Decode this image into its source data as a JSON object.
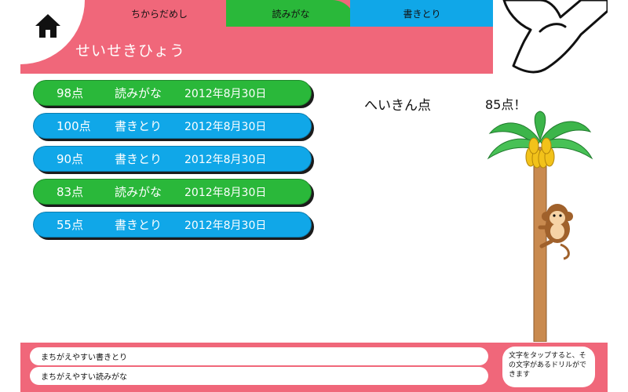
{
  "header": {
    "title": "せいせきひょう",
    "tabs": [
      {
        "label": "ちからだめし",
        "color": "#f0677a"
      },
      {
        "label": "読みがな",
        "color": "#2ab83a"
      },
      {
        "label": "書きとり",
        "color": "#10a7e8"
      }
    ]
  },
  "scores": [
    {
      "score": "98点",
      "type": "読みがな",
      "date": "2012年8月30日",
      "color": "green"
    },
    {
      "score": "100点",
      "type": "書きとり",
      "date": "2012年8月30日",
      "color": "blue"
    },
    {
      "score": "90点",
      "type": "書きとり",
      "date": "2012年8月30日",
      "color": "blue"
    },
    {
      "score": "83点",
      "type": "読みがな",
      "date": "2012年8月30日",
      "color": "green"
    },
    {
      "score": "55点",
      "type": "書きとり",
      "date": "2012年8月30日",
      "color": "blue"
    }
  ],
  "average": {
    "label": "へいきん点",
    "value": "85点！"
  },
  "footer": {
    "filters": [
      "まちがえやすい書きとり",
      "まちがえやすい読みがな"
    ],
    "hint": "文字をタップすると、その文字があるドリルができます"
  },
  "colors": {
    "accent_pink": "#f0677a",
    "reading_green": "#2ab83a",
    "writing_blue": "#10a7e8"
  },
  "icons": {
    "home": "home-icon",
    "hand": "pointing-hand-icon",
    "tree": "palm-tree-icon",
    "monkey": "monkey-icon"
  }
}
